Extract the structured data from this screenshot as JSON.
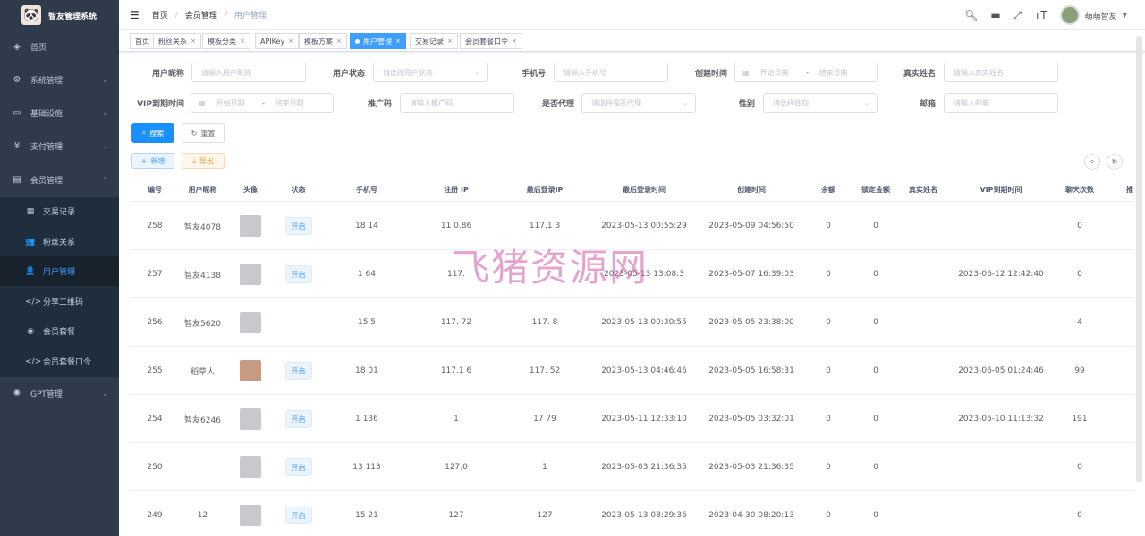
{
  "app": {
    "title": "智友管理系统",
    "logo_icon": "panda-icon"
  },
  "sidebar": {
    "items": [
      {
        "label": "首页",
        "icon": "dashboard-icon",
        "has_arrow": false
      },
      {
        "label": "系统管理",
        "icon": "gear-icon",
        "has_arrow": true
      },
      {
        "label": "基础设施",
        "icon": "monitor-icon",
        "has_arrow": true
      },
      {
        "label": "支付管理",
        "icon": "yen-icon",
        "has_arrow": true
      },
      {
        "label": "会员管理",
        "icon": "server-icon",
        "has_arrow": true,
        "expanded": true
      },
      {
        "label": "GPT管理",
        "icon": "openai-icon",
        "has_arrow": true
      }
    ],
    "sub_items": [
      {
        "label": "交易记录",
        "icon": "document-icon"
      },
      {
        "label": "粉丝关系",
        "icon": "user-group-icon"
      },
      {
        "label": "用户管理",
        "icon": "user-icon",
        "active": true
      },
      {
        "label": "分享二维码",
        "icon": "code-icon"
      },
      {
        "label": "会员套餐",
        "icon": "radio-icon"
      },
      {
        "label": "会员套餐口令",
        "icon": "code-icon"
      }
    ]
  },
  "navbar": {
    "breadcrumb": [
      "首页",
      "会员管理",
      "用户管理"
    ],
    "user_name": "萌萌智友"
  },
  "tags": [
    {
      "label": "首页",
      "closable": false
    },
    {
      "label": "粉丝关系",
      "closable": true
    },
    {
      "label": "模板分类",
      "closable": true
    },
    {
      "label": "APIKey",
      "closable": true
    },
    {
      "label": "模板方案",
      "closable": true
    },
    {
      "label": "用户管理",
      "closable": true,
      "active": true
    },
    {
      "label": "交易记录",
      "closable": true
    },
    {
      "label": "会员套餐口令",
      "closable": true
    }
  ],
  "filters": {
    "nickname": {
      "label": "用户昵称",
      "placeholder": "请输入用户昵称"
    },
    "status": {
      "label": "用户状态",
      "placeholder": "请选择用户状态"
    },
    "phone": {
      "label": "手机号",
      "placeholder": "请输入手机号"
    },
    "created": {
      "label": "创建时间",
      "start": "开始日期",
      "end": "结束日期",
      "sep": "-"
    },
    "realname": {
      "label": "真实姓名",
      "placeholder": "请输入真实姓名"
    },
    "vip": {
      "label": "VIP到期时间",
      "start": "开始日期",
      "end": "结束日期",
      "sep": "-"
    },
    "promo": {
      "label": "推广码",
      "placeholder": "请输入推广码"
    },
    "agent": {
      "label": "是否代理",
      "placeholder": "请选择是否代理"
    },
    "gender": {
      "label": "性别",
      "placeholder": "请选择性别"
    },
    "email": {
      "label": "邮箱",
      "placeholder": "请输入邮箱"
    }
  },
  "buttons": {
    "search": "搜索",
    "reset": "重置",
    "add": "新增",
    "export": "导出"
  },
  "table": {
    "columns": [
      "编号",
      "用户昵称",
      "头像",
      "状态",
      "手机号",
      "注册 IP",
      "最后登录IP",
      "最后登录时间",
      "创建时间",
      "余额",
      "锁定金额",
      "真实姓名",
      "VIP到期时间",
      "聊天次数",
      "推"
    ],
    "rows": [
      {
        "id": "258",
        "nickname": "智友4078",
        "avatar": "default",
        "status": "开启",
        "phone": "18 14",
        "reg_ip": "11 0.86",
        "last_ip": "117.1 3",
        "last_login": "2023-05-13 00:55:29",
        "created": "2023-05-09 04:56:50",
        "balance": "0",
        "locked": "0",
        "realname": "",
        "vip": "",
        "chats": "0"
      },
      {
        "id": "257",
        "nickname": "智友4138",
        "avatar": "default",
        "status": "开启",
        "phone": "1 64",
        "reg_ip": "117.",
        "last_ip": "",
        "last_login": "2023-05-13 13:08:3",
        "created": "2023-05-07 16:39:03",
        "balance": "0",
        "locked": "0",
        "realname": "",
        "vip": "2023-06-12 12:42:40",
        "chats": "0"
      },
      {
        "id": "256",
        "nickname": "智友5620",
        "avatar": "default",
        "status": "",
        "phone": "15 5",
        "reg_ip": "117. 72",
        "last_ip": "117. 8",
        "last_login": "2023-05-13 00:30:55",
        "created": "2023-05-05 23:38:00",
        "balance": "0",
        "locked": "0",
        "realname": "",
        "vip": "",
        "chats": "4"
      },
      {
        "id": "255",
        "nickname": "稻草人",
        "avatar": "photo",
        "status": "开启",
        "phone": "18 01",
        "reg_ip": "117.1 6",
        "last_ip": "117. 52",
        "last_login": "2023-05-13 04:46:46",
        "created": "2023-05-05 16:58:31",
        "balance": "0",
        "locked": "0",
        "realname": "",
        "vip": "2023-06-05 01:24:46",
        "chats": "99"
      },
      {
        "id": "254",
        "nickname": "智友6246",
        "avatar": "default",
        "status": "开启",
        "phone": "1 136",
        "reg_ip": "1",
        "last_ip": "17 79",
        "last_login": "2023-05-11 12:33:10",
        "created": "2023-05-05 03:32:01",
        "balance": "0",
        "locked": "0",
        "realname": "",
        "vip": "2023-05-10 11:13:32",
        "chats": "191"
      },
      {
        "id": "250",
        "nickname": "",
        "avatar": "default",
        "status": "开启",
        "phone": "13 113",
        "reg_ip": "127.0",
        "last_ip": "1",
        "last_login": "2023-05-03 21:36:35",
        "created": "2023-05-03 21:36:35",
        "balance": "0",
        "locked": "0",
        "realname": "",
        "vip": "",
        "chats": "0"
      },
      {
        "id": "249",
        "nickname": "12",
        "avatar": "default",
        "status": "开启",
        "phone": "15 21",
        "reg_ip": "127",
        "last_ip": "127",
        "last_login": "2023-05-13 08:29:36",
        "created": "2023-04-30 08:20:13",
        "balance": "0",
        "locked": "0",
        "realname": "",
        "vip": "",
        "chats": "0"
      }
    ]
  },
  "watermark": "飞猪资源网",
  "colors": {
    "sidebar_bg": "#2f3a4a",
    "submenu_bg": "#1f2d3d",
    "primary": "#409eff"
  }
}
